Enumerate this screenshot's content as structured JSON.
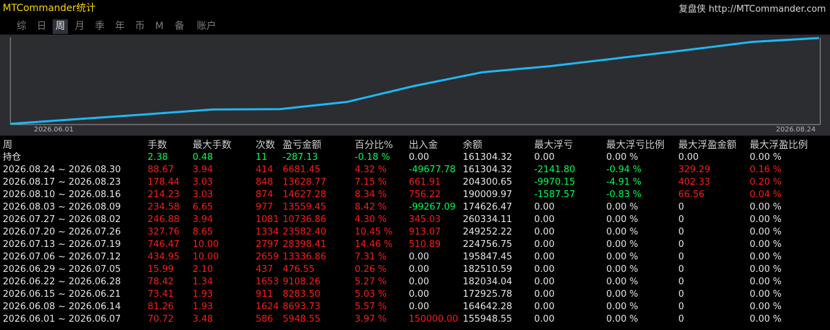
{
  "app": {
    "title": "MTCommander统计",
    "link": "复盘侠 http://MTCommander.com"
  },
  "tabs": [
    {
      "label": "综",
      "name": "tab-overall",
      "active": false
    },
    {
      "label": "日",
      "name": "tab-day",
      "active": false
    },
    {
      "label": "周",
      "name": "tab-week",
      "active": true
    },
    {
      "label": "月",
      "name": "tab-month",
      "active": false
    },
    {
      "label": "季",
      "name": "tab-quarter",
      "active": false
    },
    {
      "label": "年",
      "name": "tab-year",
      "active": false
    },
    {
      "label": "币",
      "name": "tab-currency",
      "active": false
    },
    {
      "label": "M",
      "name": "tab-m",
      "active": false
    },
    {
      "label": "备",
      "name": "tab-backup",
      "active": false
    },
    {
      "label": "账户",
      "name": "tab-account",
      "active": false
    }
  ],
  "chart_data": {
    "type": "line",
    "x_start_label": "2026.06.01",
    "x_end_label": "2026.08.24",
    "x": [
      "2026.06.01",
      "2026.06.08",
      "2026.06.15",
      "2026.06.22",
      "2026.06.29",
      "2026.07.06",
      "2026.07.13",
      "2026.07.20",
      "2026.07.27",
      "2026.08.03",
      "2026.08.10",
      "2026.08.17",
      "2026.08.24"
    ],
    "series": [
      {
        "values": [
          155948.55,
          164642.28,
          172925.78,
          182034.04,
          182510.59,
          195847.45,
          224756.75,
          249252.22,
          260334.11,
          274626.47,
          289009.97,
          304300.65,
          311304.32
        ]
      }
    ],
    "color": "#1fb8f5",
    "grid": false
  },
  "columns": [
    "周",
    "手数",
    "最大手数",
    "次数",
    "盈亏金额",
    "百分比%",
    "出入金",
    "余额",
    "最大浮亏",
    "最大浮亏比例",
    "最大浮盈金额",
    "最大浮盈比例"
  ],
  "colors": {
    "white": "#e6e6e6",
    "red": "#ff1a1a",
    "green": "#00ff55",
    "title": "#ffd700",
    "line": "#1fb8f5"
  },
  "rows": [
    {
      "cells": [
        {
          "t": "持仓",
          "c": "white"
        },
        {
          "t": "2.38",
          "c": "green"
        },
        {
          "t": "0.48",
          "c": "green"
        },
        {
          "t": "11",
          "c": "green"
        },
        {
          "t": "-287.13",
          "c": "green"
        },
        {
          "t": "-0.18 %",
          "c": "green"
        },
        {
          "t": "0.00",
          "c": "white"
        },
        {
          "t": "161304.32",
          "c": "white"
        },
        {
          "t": "0.00",
          "c": "white"
        },
        {
          "t": "0.00 %",
          "c": "white"
        },
        {
          "t": "0.00",
          "c": "white"
        },
        {
          "t": "0.00 %",
          "c": "white"
        }
      ]
    },
    {
      "cells": [
        {
          "t": "2026.08.24 ~ 2026.08.30",
          "c": "white"
        },
        {
          "t": "88.67",
          "c": "red"
        },
        {
          "t": "3.94",
          "c": "red"
        },
        {
          "t": "414",
          "c": "red"
        },
        {
          "t": "6681.45",
          "c": "red"
        },
        {
          "t": "4.32 %",
          "c": "red"
        },
        {
          "t": "-49677.78",
          "c": "green"
        },
        {
          "t": "161304.32",
          "c": "white"
        },
        {
          "t": "-2141.80",
          "c": "green"
        },
        {
          "t": "-0.94 %",
          "c": "green"
        },
        {
          "t": "329.29",
          "c": "red"
        },
        {
          "t": "0.16 %",
          "c": "red"
        }
      ]
    },
    {
      "cells": [
        {
          "t": "2026.08.17 ~ 2026.08.23",
          "c": "white"
        },
        {
          "t": "178.44",
          "c": "red"
        },
        {
          "t": "3.03",
          "c": "red"
        },
        {
          "t": "848",
          "c": "red"
        },
        {
          "t": "13628.77",
          "c": "red"
        },
        {
          "t": "7.15 %",
          "c": "red"
        },
        {
          "t": "661.91",
          "c": "red"
        },
        {
          "t": "204300.65",
          "c": "white"
        },
        {
          "t": "-9970.15",
          "c": "green"
        },
        {
          "t": "-4.91 %",
          "c": "green"
        },
        {
          "t": "402.33",
          "c": "red"
        },
        {
          "t": "0.20 %",
          "c": "red"
        }
      ]
    },
    {
      "cells": [
        {
          "t": "2026.08.10 ~ 2026.08.16",
          "c": "white"
        },
        {
          "t": "214.23",
          "c": "red"
        },
        {
          "t": "3.03",
          "c": "red"
        },
        {
          "t": "874",
          "c": "red"
        },
        {
          "t": "14627.28",
          "c": "red"
        },
        {
          "t": "8.34 %",
          "c": "red"
        },
        {
          "t": "756.22",
          "c": "red"
        },
        {
          "t": "190009.97",
          "c": "white"
        },
        {
          "t": "-1587.57",
          "c": "green"
        },
        {
          "t": "-0.83 %",
          "c": "green"
        },
        {
          "t": "66.56",
          "c": "red"
        },
        {
          "t": "0.04 %",
          "c": "red"
        }
      ]
    },
    {
      "cells": [
        {
          "t": "2026.08.03 ~ 2026.08.09",
          "c": "white"
        },
        {
          "t": "234.58",
          "c": "red"
        },
        {
          "t": "6.65",
          "c": "red"
        },
        {
          "t": "977",
          "c": "red"
        },
        {
          "t": "13559.45",
          "c": "red"
        },
        {
          "t": "8.42 %",
          "c": "red"
        },
        {
          "t": "-99267.09",
          "c": "green"
        },
        {
          "t": "174626.47",
          "c": "white"
        },
        {
          "t": "0.00",
          "c": "white"
        },
        {
          "t": "0.00 %",
          "c": "white"
        },
        {
          "t": "0",
          "c": "white"
        },
        {
          "t": "0.00 %",
          "c": "white"
        }
      ]
    },
    {
      "cells": [
        {
          "t": "2026.07.27 ~ 2026.08.02",
          "c": "white"
        },
        {
          "t": "246.88",
          "c": "red"
        },
        {
          "t": "3.94",
          "c": "red"
        },
        {
          "t": "1081",
          "c": "red"
        },
        {
          "t": "10736.86",
          "c": "red"
        },
        {
          "t": "4.30 %",
          "c": "red"
        },
        {
          "t": "345.03",
          "c": "red"
        },
        {
          "t": "260334.11",
          "c": "white"
        },
        {
          "t": "0.00",
          "c": "white"
        },
        {
          "t": "0.00 %",
          "c": "white"
        },
        {
          "t": "0",
          "c": "white"
        },
        {
          "t": "0.00 %",
          "c": "white"
        }
      ]
    },
    {
      "cells": [
        {
          "t": "2026.07.20 ~ 2026.07.26",
          "c": "white"
        },
        {
          "t": "327.76",
          "c": "red"
        },
        {
          "t": "8.65",
          "c": "red"
        },
        {
          "t": "1334",
          "c": "red"
        },
        {
          "t": "23582.40",
          "c": "red"
        },
        {
          "t": "10.45 %",
          "c": "red"
        },
        {
          "t": "913.07",
          "c": "red"
        },
        {
          "t": "249252.22",
          "c": "white"
        },
        {
          "t": "0.00",
          "c": "white"
        },
        {
          "t": "0.00 %",
          "c": "white"
        },
        {
          "t": "0",
          "c": "white"
        },
        {
          "t": "0.00 %",
          "c": "white"
        }
      ]
    },
    {
      "cells": [
        {
          "t": "2026.07.13 ~ 2026.07.19",
          "c": "white"
        },
        {
          "t": "746.47",
          "c": "red"
        },
        {
          "t": "10.00",
          "c": "red"
        },
        {
          "t": "2797",
          "c": "red"
        },
        {
          "t": "28398.41",
          "c": "red"
        },
        {
          "t": "14.46 %",
          "c": "red"
        },
        {
          "t": "510.89",
          "c": "red"
        },
        {
          "t": "224756.75",
          "c": "white"
        },
        {
          "t": "0.00",
          "c": "white"
        },
        {
          "t": "0.00 %",
          "c": "white"
        },
        {
          "t": "0",
          "c": "white"
        },
        {
          "t": "0.00 %",
          "c": "white"
        }
      ]
    },
    {
      "cells": [
        {
          "t": "2026.07.06 ~ 2026.07.12",
          "c": "white"
        },
        {
          "t": "434.95",
          "c": "red"
        },
        {
          "t": "10.00",
          "c": "red"
        },
        {
          "t": "2659",
          "c": "red"
        },
        {
          "t": "13336.86",
          "c": "red"
        },
        {
          "t": "7.31 %",
          "c": "red"
        },
        {
          "t": "0.00",
          "c": "white"
        },
        {
          "t": "195847.45",
          "c": "white"
        },
        {
          "t": "0.00",
          "c": "white"
        },
        {
          "t": "0.00 %",
          "c": "white"
        },
        {
          "t": "0",
          "c": "white"
        },
        {
          "t": "0.00 %",
          "c": "white"
        }
      ]
    },
    {
      "cells": [
        {
          "t": "2026.06.29 ~ 2026.07.05",
          "c": "white"
        },
        {
          "t": "15.99",
          "c": "red"
        },
        {
          "t": "2.10",
          "c": "red"
        },
        {
          "t": "437",
          "c": "red"
        },
        {
          "t": "476.55",
          "c": "red"
        },
        {
          "t": "0.26 %",
          "c": "red"
        },
        {
          "t": "0.00",
          "c": "white"
        },
        {
          "t": "182510.59",
          "c": "white"
        },
        {
          "t": "0.00",
          "c": "white"
        },
        {
          "t": "0.00 %",
          "c": "white"
        },
        {
          "t": "0",
          "c": "white"
        },
        {
          "t": "0.00 %",
          "c": "white"
        }
      ]
    },
    {
      "cells": [
        {
          "t": "2026.06.22 ~ 2026.06.28",
          "c": "white"
        },
        {
          "t": "78.42",
          "c": "red"
        },
        {
          "t": "1.34",
          "c": "red"
        },
        {
          "t": "1653",
          "c": "red"
        },
        {
          "t": "9108.26",
          "c": "red"
        },
        {
          "t": "5.27 %",
          "c": "red"
        },
        {
          "t": "0.00",
          "c": "white"
        },
        {
          "t": "182034.04",
          "c": "white"
        },
        {
          "t": "0.00",
          "c": "white"
        },
        {
          "t": "0.00 %",
          "c": "white"
        },
        {
          "t": "0",
          "c": "white"
        },
        {
          "t": "0.00 %",
          "c": "white"
        }
      ]
    },
    {
      "cells": [
        {
          "t": "2026.06.15 ~ 2026.06.21",
          "c": "white"
        },
        {
          "t": "73.41",
          "c": "red"
        },
        {
          "t": "1.93",
          "c": "red"
        },
        {
          "t": "911",
          "c": "red"
        },
        {
          "t": "8283.50",
          "c": "red"
        },
        {
          "t": "5.03 %",
          "c": "red"
        },
        {
          "t": "0.00",
          "c": "white"
        },
        {
          "t": "172925.78",
          "c": "white"
        },
        {
          "t": "0.00",
          "c": "white"
        },
        {
          "t": "0.00 %",
          "c": "white"
        },
        {
          "t": "0",
          "c": "white"
        },
        {
          "t": "0.00 %",
          "c": "white"
        }
      ]
    },
    {
      "cells": [
        {
          "t": "2026.06.08 ~ 2026.06.14",
          "c": "white"
        },
        {
          "t": "81.26",
          "c": "red"
        },
        {
          "t": "1.93",
          "c": "red"
        },
        {
          "t": "1624",
          "c": "red"
        },
        {
          "t": "8693.73",
          "c": "red"
        },
        {
          "t": "5.57 %",
          "c": "red"
        },
        {
          "t": "0.00",
          "c": "white"
        },
        {
          "t": "164642.28",
          "c": "white"
        },
        {
          "t": "0.00",
          "c": "white"
        },
        {
          "t": "0.00 %",
          "c": "white"
        },
        {
          "t": "0",
          "c": "white"
        },
        {
          "t": "0.00 %",
          "c": "white"
        }
      ]
    },
    {
      "cells": [
        {
          "t": "2026.06.01 ~ 2026.06.07",
          "c": "white"
        },
        {
          "t": "70.72",
          "c": "red"
        },
        {
          "t": "3.48",
          "c": "red"
        },
        {
          "t": "586",
          "c": "red"
        },
        {
          "t": "5948.55",
          "c": "red"
        },
        {
          "t": "3.97 %",
          "c": "red"
        },
        {
          "t": "150000.00",
          "c": "red"
        },
        {
          "t": "155948.55",
          "c": "white"
        },
        {
          "t": "0.00",
          "c": "white"
        },
        {
          "t": "0.00 %",
          "c": "white"
        },
        {
          "t": "0",
          "c": "white"
        },
        {
          "t": "0.00 %",
          "c": "white"
        }
      ]
    }
  ]
}
